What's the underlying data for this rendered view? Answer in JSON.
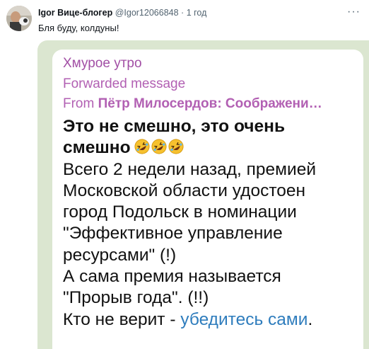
{
  "tweet": {
    "author_name": "Igor Вице-блогер",
    "handle": "@Igor12066848",
    "separator": "·",
    "time": "1 год",
    "text": "Бля буду, колдуны!",
    "more": "···"
  },
  "message": {
    "chat_name": "Хмурое утро",
    "forwarded_label": "Forwarded message",
    "from_prefix": "From ",
    "from_author": "Пётр Милосердов: Соображени…",
    "title_line1": "Это не смешно, это очень",
    "title_line2": "смешно",
    "body_lines": [
      "Всего 2 недели назад, премией",
      "Московской области удостоен",
      "город Подольск в номинации",
      "\"Эффективное управление",
      "ресурсами\" (!)",
      "А сама премия называется",
      "\"Прорыв года\". (!!)"
    ],
    "last_prefix": "Кто не верит - ",
    "link_text": "убедитесь сами",
    "last_suffix": "."
  },
  "colors": {
    "card_bg": "#dbe6d0",
    "chat_name": "#a24fa5",
    "link": "#2f7dbd"
  },
  "icons": [
    "avatar-photo",
    "rolling-laughing-emoji",
    "more-icon"
  ]
}
